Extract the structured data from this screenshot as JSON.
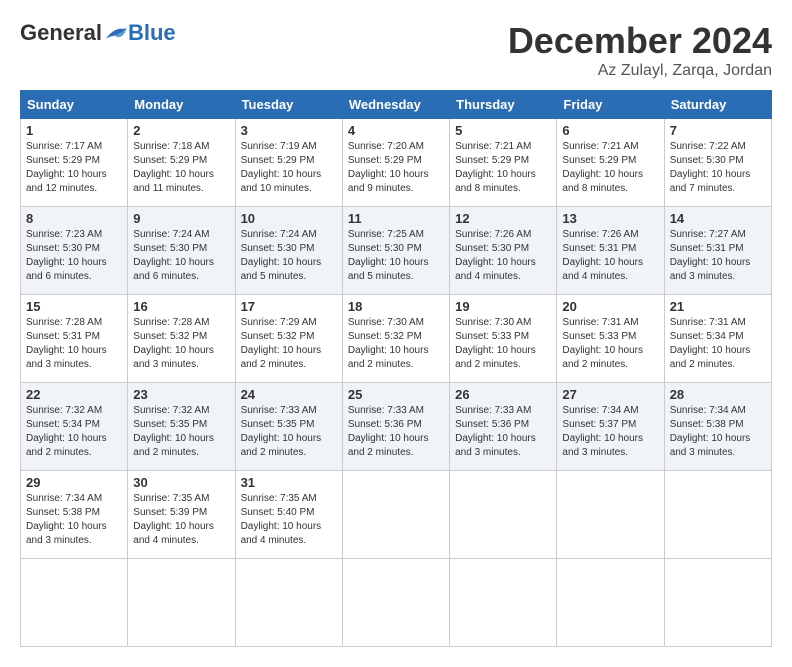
{
  "header": {
    "logo": {
      "general": "General",
      "blue": "Blue"
    },
    "title": "December 2024",
    "location": "Az Zulayl, Zarqa, Jordan"
  },
  "calendar": {
    "days_of_week": [
      "Sunday",
      "Monday",
      "Tuesday",
      "Wednesday",
      "Thursday",
      "Friday",
      "Saturday"
    ],
    "weeks": [
      [
        null,
        null,
        null,
        null,
        null,
        null,
        null
      ]
    ],
    "cells": [
      {
        "day": 1,
        "col": 0,
        "sunrise": "7:17 AM",
        "sunset": "5:29 PM",
        "daylight": "10 hours and 12 minutes."
      },
      {
        "day": 2,
        "col": 1,
        "sunrise": "7:18 AM",
        "sunset": "5:29 PM",
        "daylight": "10 hours and 11 minutes."
      },
      {
        "day": 3,
        "col": 2,
        "sunrise": "7:19 AM",
        "sunset": "5:29 PM",
        "daylight": "10 hours and 10 minutes."
      },
      {
        "day": 4,
        "col": 3,
        "sunrise": "7:20 AM",
        "sunset": "5:29 PM",
        "daylight": "10 hours and 9 minutes."
      },
      {
        "day": 5,
        "col": 4,
        "sunrise": "7:21 AM",
        "sunset": "5:29 PM",
        "daylight": "10 hours and 8 minutes."
      },
      {
        "day": 6,
        "col": 5,
        "sunrise": "7:21 AM",
        "sunset": "5:29 PM",
        "daylight": "10 hours and 8 minutes."
      },
      {
        "day": 7,
        "col": 6,
        "sunrise": "7:22 AM",
        "sunset": "5:30 PM",
        "daylight": "10 hours and 7 minutes."
      },
      {
        "day": 8,
        "col": 0,
        "sunrise": "7:23 AM",
        "sunset": "5:30 PM",
        "daylight": "10 hours and 6 minutes."
      },
      {
        "day": 9,
        "col": 1,
        "sunrise": "7:24 AM",
        "sunset": "5:30 PM",
        "daylight": "10 hours and 6 minutes."
      },
      {
        "day": 10,
        "col": 2,
        "sunrise": "7:24 AM",
        "sunset": "5:30 PM",
        "daylight": "10 hours and 5 minutes."
      },
      {
        "day": 11,
        "col": 3,
        "sunrise": "7:25 AM",
        "sunset": "5:30 PM",
        "daylight": "10 hours and 5 minutes."
      },
      {
        "day": 12,
        "col": 4,
        "sunrise": "7:26 AM",
        "sunset": "5:30 PM",
        "daylight": "10 hours and 4 minutes."
      },
      {
        "day": 13,
        "col": 5,
        "sunrise": "7:26 AM",
        "sunset": "5:31 PM",
        "daylight": "10 hours and 4 minutes."
      },
      {
        "day": 14,
        "col": 6,
        "sunrise": "7:27 AM",
        "sunset": "5:31 PM",
        "daylight": "10 hours and 3 minutes."
      },
      {
        "day": 15,
        "col": 0,
        "sunrise": "7:28 AM",
        "sunset": "5:31 PM",
        "daylight": "10 hours and 3 minutes."
      },
      {
        "day": 16,
        "col": 1,
        "sunrise": "7:28 AM",
        "sunset": "5:32 PM",
        "daylight": "10 hours and 3 minutes."
      },
      {
        "day": 17,
        "col": 2,
        "sunrise": "7:29 AM",
        "sunset": "5:32 PM",
        "daylight": "10 hours and 2 minutes."
      },
      {
        "day": 18,
        "col": 3,
        "sunrise": "7:30 AM",
        "sunset": "5:32 PM",
        "daylight": "10 hours and 2 minutes."
      },
      {
        "day": 19,
        "col": 4,
        "sunrise": "7:30 AM",
        "sunset": "5:33 PM",
        "daylight": "10 hours and 2 minutes."
      },
      {
        "day": 20,
        "col": 5,
        "sunrise": "7:31 AM",
        "sunset": "5:33 PM",
        "daylight": "10 hours and 2 minutes."
      },
      {
        "day": 21,
        "col": 6,
        "sunrise": "7:31 AM",
        "sunset": "5:34 PM",
        "daylight": "10 hours and 2 minutes."
      },
      {
        "day": 22,
        "col": 0,
        "sunrise": "7:32 AM",
        "sunset": "5:34 PM",
        "daylight": "10 hours and 2 minutes."
      },
      {
        "day": 23,
        "col": 1,
        "sunrise": "7:32 AM",
        "sunset": "5:35 PM",
        "daylight": "10 hours and 2 minutes."
      },
      {
        "day": 24,
        "col": 2,
        "sunrise": "7:33 AM",
        "sunset": "5:35 PM",
        "daylight": "10 hours and 2 minutes."
      },
      {
        "day": 25,
        "col": 3,
        "sunrise": "7:33 AM",
        "sunset": "5:36 PM",
        "daylight": "10 hours and 2 minutes."
      },
      {
        "day": 26,
        "col": 4,
        "sunrise": "7:33 AM",
        "sunset": "5:36 PM",
        "daylight": "10 hours and 3 minutes."
      },
      {
        "day": 27,
        "col": 5,
        "sunrise": "7:34 AM",
        "sunset": "5:37 PM",
        "daylight": "10 hours and 3 minutes."
      },
      {
        "day": 28,
        "col": 6,
        "sunrise": "7:34 AM",
        "sunset": "5:38 PM",
        "daylight": "10 hours and 3 minutes."
      },
      {
        "day": 29,
        "col": 0,
        "sunrise": "7:34 AM",
        "sunset": "5:38 PM",
        "daylight": "10 hours and 3 minutes."
      },
      {
        "day": 30,
        "col": 1,
        "sunrise": "7:35 AM",
        "sunset": "5:39 PM",
        "daylight": "10 hours and 4 minutes."
      },
      {
        "day": 31,
        "col": 2,
        "sunrise": "7:35 AM",
        "sunset": "5:40 PM",
        "daylight": "10 hours and 4 minutes."
      }
    ]
  }
}
